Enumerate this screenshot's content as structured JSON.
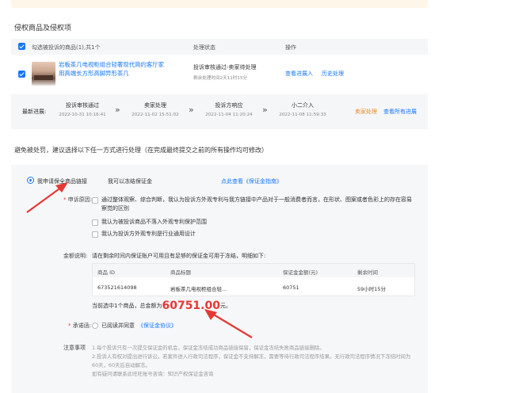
{
  "section_title": "侵权商品及侵权项",
  "table": {
    "select_all_label": "勾选被投诉的商品(1),共1个",
    "col_status": "处理状态",
    "col_action": "操作",
    "row": {
      "product_name": "岩板茶几电视柜组合轻奢现代简约客厅家用高端长方形高脚异形茶几",
      "status": "投诉审核通过-卖家待处理",
      "status_time": "剩余处理时间2天11时15分",
      "action_view": "查看进展入",
      "action_history": "历史处理"
    }
  },
  "progress": {
    "label": "最新进展:",
    "steps": [
      {
        "title": "投诉审核通过",
        "date": "2022-10-31 10:16:41"
      },
      {
        "title": "卖家处理",
        "date": "2022-11-02 15:51:02"
      },
      {
        "title": "投诉方响应",
        "date": "2022-11-04 11:20:24"
      },
      {
        "title": "小二介入",
        "date": "2022-11-08 11:59:33"
      }
    ],
    "arrow": "»",
    "seller_action": "卖家处理",
    "view_all": "查看所有进展"
  },
  "notice": "避免被处罚，建议选择以下任一方式进行处理（在完成最终提交之前的所有操作均可修改）",
  "options": {
    "apply_guarantee": "我申请保全商品链接",
    "freeze_deposit": "我可以冻结保证金",
    "view_guide": "点此查看《保证金指南》"
  },
  "appeal": {
    "label": "申诉原因:",
    "reasons": [
      "通过整体观察、综合判断，我认为投诉方外观专利与我方链接中产品对于一般消费者而言，在形状、图案或者色彩上的存在容易察觉的区别",
      "我认为被投诉商品不落入外观专利保护范围",
      "我认为投诉方外观专利是行业通用设计"
    ]
  },
  "amount": {
    "label": "金额说明:",
    "desc": "请在剩余时间内保证账户可用且有足够的保证金可用于冻结，明细如下:",
    "headers": [
      "商品 ID",
      "商品标题",
      "保证金金额(元)",
      "剩余时间"
    ],
    "row": [
      "673521614098",
      "岩板茶几电视柜组合轻...",
      "60751",
      "59小时15分"
    ],
    "total_prefix": "当前选中1个商品，总金额为",
    "total_amount": "60751.00",
    "total_suffix": "元。"
  },
  "promise": {
    "label": "承诺函:",
    "agree_text": "已阅读并同意",
    "agreement_link": "《保证金协议》"
  },
  "notes": {
    "label": "注意事项",
    "lines": [
      "1.每个投诉只有一次提交保证金的机会，保证金冻结成功商品链接保留，保证金冻结失败商品链接删除。",
      "2.投诉人有权对提出进行诉讼，若案件进入行政司法程序，保证金不支持解冻，需要等待行政司法程序结果。无行政司法程序情况下冻结时间为60天，60天后自动解冻。",
      "如有疑问请联系此旺旺账号咨询：知识产权保证金咨询"
    ]
  },
  "colors": {
    "accent": "#1677ff",
    "orange": "#f08a24",
    "red": "#e53935"
  }
}
